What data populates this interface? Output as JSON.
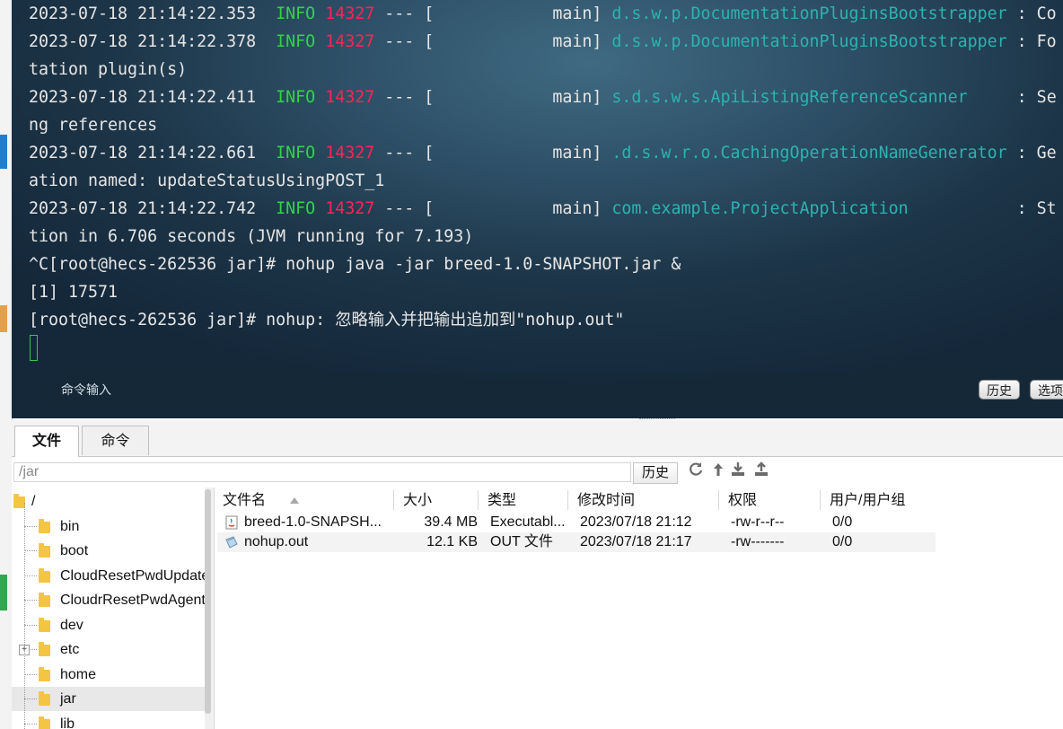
{
  "terminal": {
    "lines": [
      {
        "ts": "2023-07-18 21:14:22.353",
        "level": "INFO",
        "pid": "14327",
        "sep": " --- [",
        "thread": "main]",
        "logger": "d.s.w.p.DocumentationPluginsBootstrapper",
        "tail": " : Co"
      },
      {
        "ts": "2023-07-18 21:14:22.378",
        "level": "INFO",
        "pid": "14327",
        "sep": " --- [",
        "thread": "main]",
        "logger": "d.s.w.p.DocumentationPluginsBootstrapper",
        "tail": " : Fo"
      },
      {
        "text": "tation plugin(s)"
      },
      {
        "ts": "2023-07-18 21:14:22.411",
        "level": "INFO",
        "pid": "14327",
        "sep": " --- [",
        "thread": "main]",
        "logger": "s.d.s.w.s.ApiListingReferenceScanner",
        "tail": "     : Se"
      },
      {
        "text": "ng references"
      },
      {
        "ts": "2023-07-18 21:14:22.661",
        "level": "INFO",
        "pid": "14327",
        "sep": " --- [",
        "thread": "main]",
        "logger": ".d.s.w.r.o.CachingOperationNameGenerator",
        "tail": " : Ge"
      },
      {
        "text": "ation named: updateStatusUsingPOST_1"
      },
      {
        "ts": "2023-07-18 21:14:22.742",
        "level": "INFO",
        "pid": "14327",
        "sep": " --- [",
        "thread": "main]",
        "logger": "com.example.ProjectApplication",
        "tail": "           : St"
      },
      {
        "text": "tion in 6.706 seconds (JVM running for 7.193)"
      },
      {
        "text": "^C[root@hecs-262536 jar]# nohup java -jar breed-1.0-SNAPSHOT.jar &"
      },
      {
        "text": "[1] 17571"
      },
      {
        "text": "[root@hecs-262536 jar]# nohup: 忽略输入并把输出追加到\"nohup.out\""
      }
    ],
    "command_placeholder": "命令输入",
    "history_button": "历史",
    "options_button": "选项"
  },
  "filepanel": {
    "tabs": [
      "文件",
      "命令"
    ],
    "path": "/jar",
    "history_button": "历史",
    "toolbar_icons": [
      "refresh-icon",
      "up-dir-icon",
      "download-icon",
      "upload-icon"
    ],
    "tree": [
      {
        "label": "/",
        "level": 0
      },
      {
        "label": "bin",
        "level": 1
      },
      {
        "label": "boot",
        "level": 1
      },
      {
        "label": "CloudResetPwdUpdateAgent",
        "level": 1
      },
      {
        "label": "CloudrResetPwdAgent",
        "level": 1
      },
      {
        "label": "dev",
        "level": 1
      },
      {
        "label": "etc",
        "level": 1,
        "expandable": true
      },
      {
        "label": "home",
        "level": 1
      },
      {
        "label": "jar",
        "level": 1,
        "selected": true
      },
      {
        "label": "lib",
        "level": 1
      }
    ],
    "columns": [
      "文件名",
      "大小",
      "类型",
      "修改时间",
      "权限",
      "用户/用户组"
    ],
    "files": [
      {
        "name": "breed-1.0-SNAPSH...",
        "size": "39.4 MB",
        "type": "Executabl...",
        "mtime": "2023/07/18 21:12",
        "perm": "-rw-r--r--",
        "owner": "0/0",
        "icon": "jar-file-icon"
      },
      {
        "name": "nohup.out",
        "size": "12.1 KB",
        "type": "OUT 文件",
        "mtime": "2023/07/18 21:17",
        "perm": "-rw-------",
        "owner": "0/0",
        "icon": "out-file-icon"
      }
    ]
  },
  "colors": {
    "info": "#34d24a",
    "pid": "#ff2357",
    "logger": "#2cb3b0",
    "folder": "#f4c542"
  }
}
